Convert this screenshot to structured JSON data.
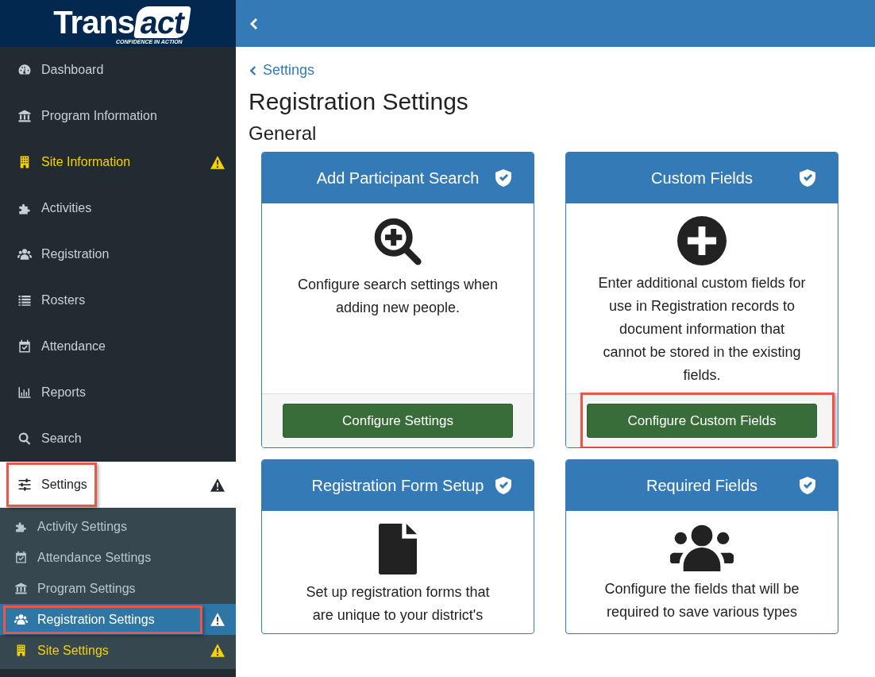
{
  "logo": {
    "word": "Trans",
    "badge": "act",
    "tagline": "CONFIDENCE IN ACTION"
  },
  "sidebar": {
    "items": [
      {
        "label": "Dashboard",
        "alert": false,
        "warning": false,
        "selected": false,
        "highlighted": false
      },
      {
        "label": "Program Information",
        "alert": false,
        "warning": false,
        "selected": false,
        "highlighted": false
      },
      {
        "label": "Site Information",
        "alert": true,
        "warning": true,
        "selected": false,
        "highlighted": false
      },
      {
        "label": "Activities",
        "alert": false,
        "warning": false,
        "selected": false,
        "highlighted": false
      },
      {
        "label": "Registration",
        "alert": false,
        "warning": false,
        "selected": false,
        "highlighted": false
      },
      {
        "label": "Rosters",
        "alert": false,
        "warning": false,
        "selected": false,
        "highlighted": false
      },
      {
        "label": "Attendance",
        "alert": false,
        "warning": false,
        "selected": false,
        "highlighted": false
      },
      {
        "label": "Reports",
        "alert": false,
        "warning": false,
        "selected": false,
        "highlighted": false
      },
      {
        "label": "Search",
        "alert": false,
        "warning": false,
        "selected": false,
        "highlighted": false
      },
      {
        "label": "Settings",
        "alert": false,
        "warning": true,
        "selected": true,
        "highlighted": true,
        "expanded": true,
        "children": [
          {
            "label": "Activity Settings",
            "alert": false,
            "warning": false,
            "selected": false,
            "highlighted": false
          },
          {
            "label": "Attendance Settings",
            "alert": false,
            "warning": false,
            "selected": false,
            "highlighted": false
          },
          {
            "label": "Program Settings",
            "alert": false,
            "warning": false,
            "selected": false,
            "highlighted": false
          },
          {
            "label": "Registration Settings",
            "alert": false,
            "warning": true,
            "selected": true,
            "highlighted": true
          },
          {
            "label": "Site Settings",
            "alert": true,
            "warning": true,
            "selected": false,
            "highlighted": false
          }
        ]
      }
    ]
  },
  "breadcrumb": "Settings",
  "title": "Registration Settings",
  "section": "General",
  "cards": [
    {
      "title": "Add Participant Search",
      "verified": true,
      "description": "Configure search settings when adding new people.",
      "button": "Configure Settings",
      "highlighted": false
    },
    {
      "title": "Custom Fields",
      "verified": true,
      "description": "Enter additional custom fields for use in Registration records to document information that cannot be stored in the existing fields.",
      "button": "Configure Custom Fields",
      "highlighted": true
    },
    {
      "title": "Registration Form Setup",
      "verified": true,
      "description": "Set up registration forms that are unique to your district's"
    },
    {
      "title": "Required Fields",
      "verified": true,
      "description": "Configure the fields that will be required to save various types"
    }
  ]
}
